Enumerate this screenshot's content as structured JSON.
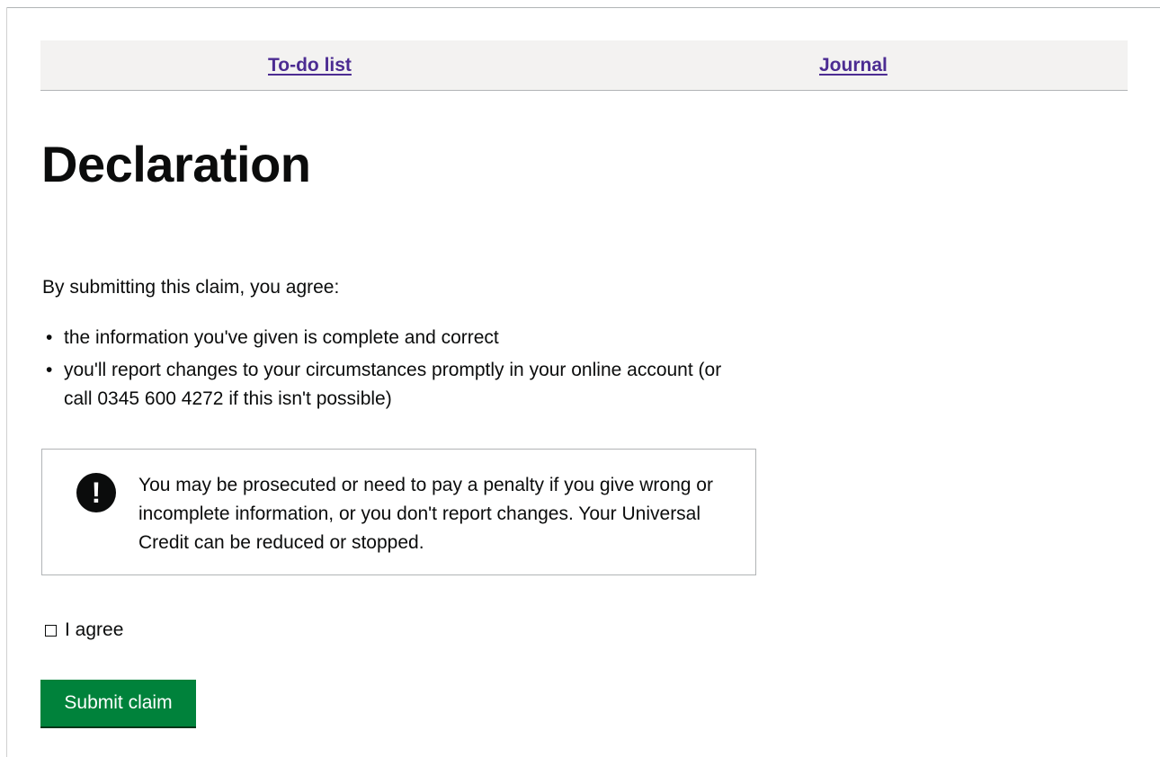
{
  "nav": {
    "todo_label": "To-do list",
    "journal_label": "Journal"
  },
  "page": {
    "title": "Declaration",
    "intro": "By submitting this claim, you agree:",
    "points": [
      "the information you've given is complete and correct",
      "you'll report changes to your circumstances promptly in your online account (or call 0345 600 4272 if this isn't possible)"
    ]
  },
  "warning": {
    "icon": "!",
    "icon_name": "exclamation-icon",
    "text": "You may be prosecuted or need to pay a penalty if you give wrong or incomplete information, or you don't report changes. Your Universal Credit can be reduced or stopped."
  },
  "agreement": {
    "label": "I agree",
    "checked": false
  },
  "actions": {
    "submit_label": "Submit claim"
  },
  "colors": {
    "link": "#4c2c92",
    "button": "#00823b",
    "text": "#0b0c0c",
    "nav_background": "#f3f2f1"
  }
}
